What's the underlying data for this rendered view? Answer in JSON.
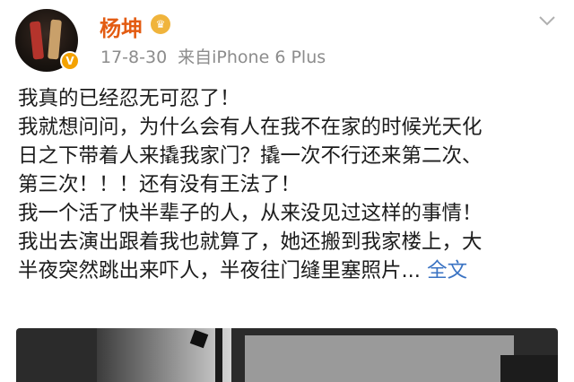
{
  "post": {
    "username": "杨坤",
    "date": "17-8-30",
    "source": "来自iPhone 6 Plus",
    "lines": [
      "我真的已经忍无可忍了！",
      "我就想问问，为什么会有人在我不在家的时候光天化",
      "日之下带着人来撬我家门？撬一次不行还来第二次、",
      "第三次！！！还有没有王法了！",
      "我一个活了快半辈子的人，从来没见过这样的事情！",
      "我出去演出跟着我也就算了，她还搬到我家楼上，大",
      "半夜突然跳出来吓人，半夜往门缝里塞照片..."
    ],
    "expand_label": "全文"
  },
  "icons": {
    "avatar": "avatar-image",
    "verified": "verified-v-badge",
    "crown": "crown-badge-icon",
    "more": "chevron-down-icon"
  },
  "colors": {
    "username": "#e35c12",
    "meta": "#8c8c8c",
    "link": "#3a73c3",
    "verified": "#f4a200"
  }
}
